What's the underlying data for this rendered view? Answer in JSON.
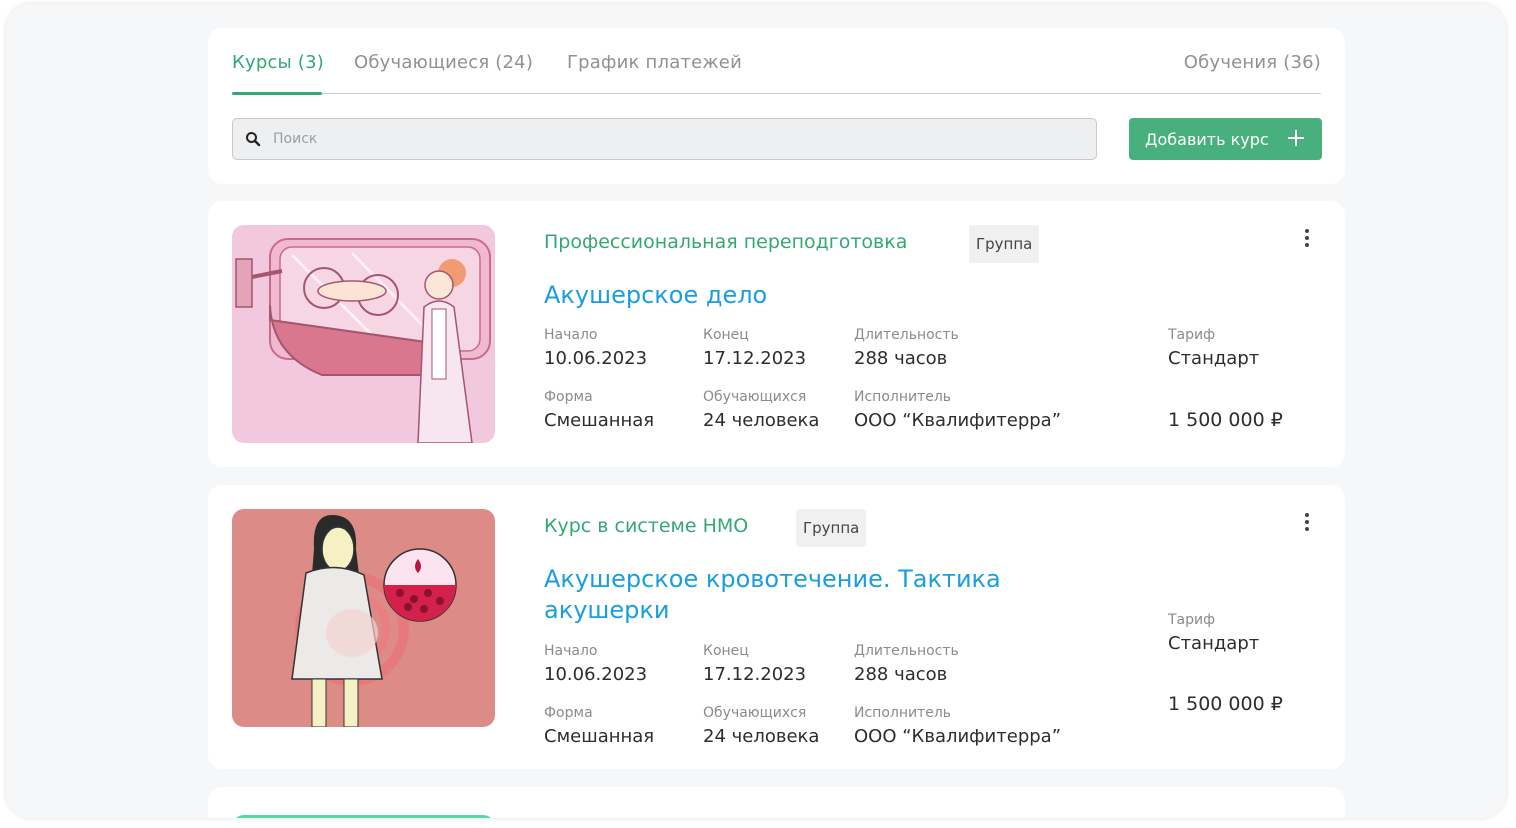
{
  "tabs": [
    {
      "label": "Курсы (3)"
    },
    {
      "label": "Обучающиеся (24)"
    },
    {
      "label": "График платежей"
    },
    {
      "label": "Обучения (36)"
    }
  ],
  "search": {
    "placeholder": "Поиск"
  },
  "add_button": {
    "label": "Добавить курс"
  },
  "courses": [
    {
      "category": "Профессиональная переподготовка",
      "badge": "Группа",
      "title": "Акушерское дело",
      "start_label": "Начало",
      "start": "10.06.2023",
      "end_label": "Конец",
      "end": "17.12.2023",
      "duration_label": "Длительность",
      "duration": "288 часов",
      "tariff_label": "Тариф",
      "tariff": "Стандарт",
      "form_label": "Форма",
      "form": "Смешанная",
      "students_label": "Обучающихся",
      "students": "24 человека",
      "executor_label": "Исполнитель",
      "executor": "ООО “Квалифитерра”",
      "price": "1 500 000 ₽"
    },
    {
      "category": "Курс в системе НМО",
      "badge": "Группа",
      "title": "Акушерское кровотечение. Тактика акушерки",
      "start_label": "Начало",
      "start": "10.06.2023",
      "end_label": "Конец",
      "end": "17.12.2023",
      "duration_label": "Длительность",
      "duration": "288 часов",
      "tariff_label": "Тариф",
      "tariff": "Стандарт",
      "form_label": "Форма",
      "form": "Смешанная",
      "students_label": "Обучающихся",
      "students": "24 человека",
      "executor_label": "Исполнитель",
      "executor": "ООО “Квалифитерра”",
      "price": "1 500 000 ₽"
    }
  ],
  "colors": {
    "accent": "#34a874",
    "title": "#1a9ee0",
    "button": "#48b07d"
  }
}
